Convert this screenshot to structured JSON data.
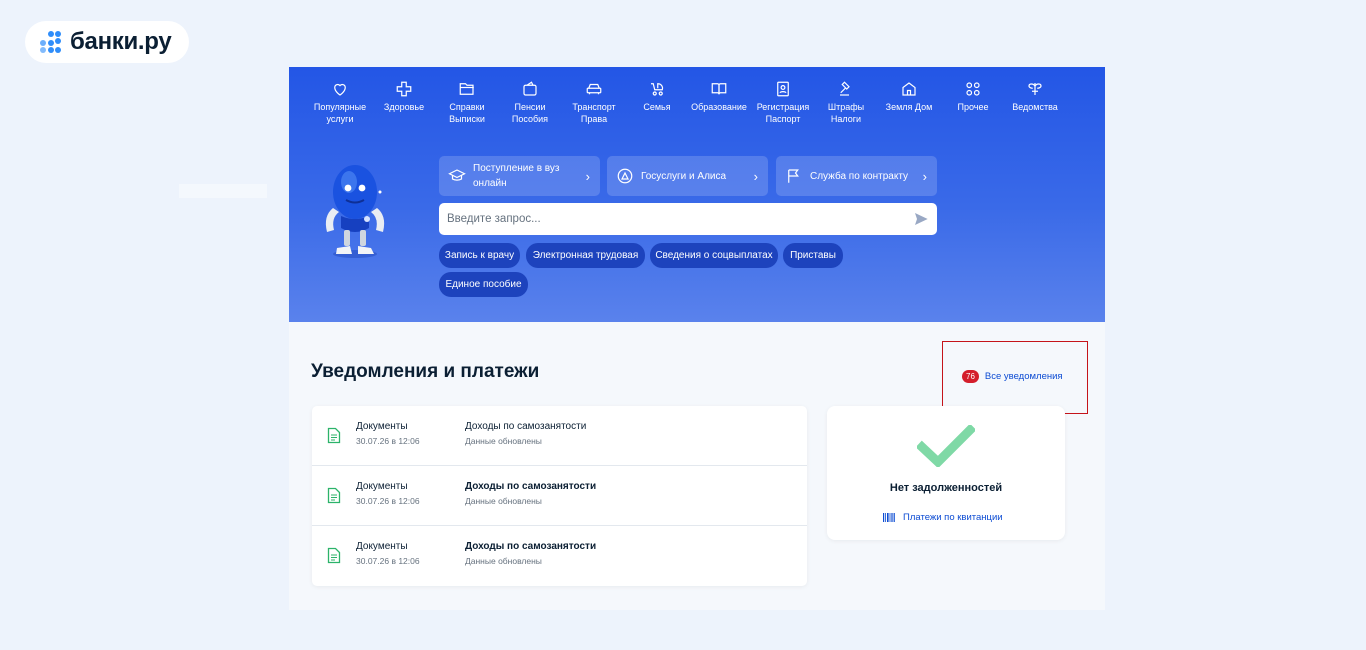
{
  "brand": {
    "logo_text": "банки.ру"
  },
  "nav": {
    "items": [
      {
        "label": "Популярные\nуслуги",
        "icon": "heart-icon"
      },
      {
        "label": "Здоровье",
        "icon": "plus-icon"
      },
      {
        "label": "Справки\nВыписки",
        "icon": "folder-icon"
      },
      {
        "label": "Пенсии\nПособия",
        "icon": "wallet-icon"
      },
      {
        "label": "Транспорт\nПрава",
        "icon": "car-icon"
      },
      {
        "label": "Семья",
        "icon": "stroller-icon"
      },
      {
        "label": "Образование",
        "icon": "book-icon"
      },
      {
        "label": "Регистрация\nПаспорт",
        "icon": "id-card-icon"
      },
      {
        "label": "Штрафы\nНалоги",
        "icon": "gavel-icon"
      },
      {
        "label": "Земля Дом",
        "icon": "house-icon"
      },
      {
        "label": "Прочее",
        "icon": "grid-icon"
      },
      {
        "label": "Ведомства",
        "icon": "emblem-icon"
      }
    ]
  },
  "promo": [
    {
      "label": "Поступление в вуз онлайн",
      "icon": "graduation-cap-icon"
    },
    {
      "label": "Госуслуги и Алиса",
      "icon": "alice-icon"
    },
    {
      "label": "Служба по контракту",
      "icon": "flag-icon"
    }
  ],
  "search": {
    "placeholder": "Введите запрос..."
  },
  "quick_tags": [
    "Запись к врачу",
    "Электронная трудовая",
    "Сведения о соцвыплатах",
    "Приставы",
    "Единое пособие"
  ],
  "notifications": {
    "title": "Уведомления и платежи",
    "badge_count": "76",
    "all_link": "Все уведомления",
    "rows": [
      {
        "type": "Документы",
        "date": "30.07.26 в 12:06",
        "title": "Доходы по самозанятости",
        "status": "Данные обновлены"
      },
      {
        "type": "Документы",
        "date": "30.07.26 в 12:06",
        "title": "Доходы по самозанятости",
        "status": "Данные обновлены"
      },
      {
        "type": "Документы",
        "date": "30.07.26 в 12:06",
        "title": "Доходы по самозанятости",
        "status": "Данные обновлены"
      }
    ]
  },
  "debts": {
    "title": "Нет задолженностей",
    "pay_link": "Платежи по квитанции"
  },
  "colors": {
    "hero_blue": "#2356e6",
    "link_blue": "#0d4cd3",
    "badge_red": "#d41e2c",
    "check_green": "#7fd9a6",
    "highlight_box": "#c5141a"
  }
}
